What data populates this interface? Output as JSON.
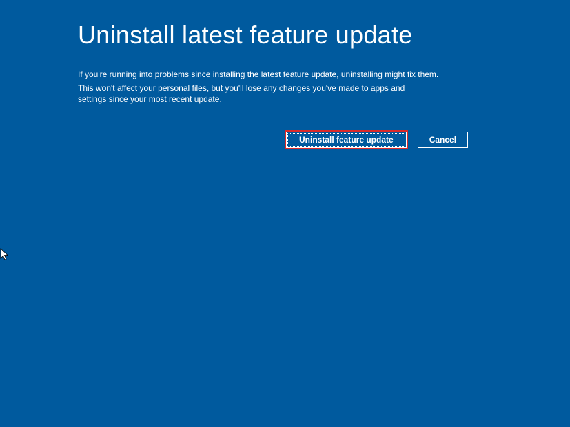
{
  "page": {
    "title": "Uninstall latest feature update",
    "paragraph1": "If you're running into problems since installing the latest feature update, uninstalling might fix them.",
    "paragraph2": "This won't affect your personal files, but you'll lose any changes you've made to apps and settings since your most recent update."
  },
  "buttons": {
    "primary_label": "Uninstall feature update",
    "cancel_label": "Cancel"
  },
  "colors": {
    "background": "#005a9e",
    "text": "#ffffff",
    "highlight_border": "#d92a2a"
  }
}
